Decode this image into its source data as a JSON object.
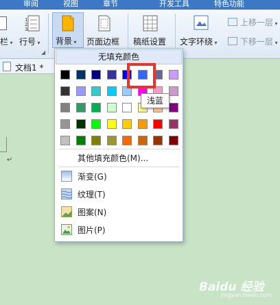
{
  "menu_tabs": [
    "审阅",
    "视图",
    "章节",
    "开发工具",
    "特色功能"
  ],
  "ribbon": {
    "left_cut_label": "栏",
    "line_spacing_label": "行号",
    "background_label": "背景",
    "page_border_label": "页面边框",
    "paper_setting_label": "稿纸设置",
    "text_wrap_label": "文字环绕",
    "bring_forward_label": "上移一层",
    "send_backward_label": "下移一层"
  },
  "document_tab": {
    "name": "文档1 *"
  },
  "dropdown": {
    "no_fill_label": "无填充颜色",
    "palette": [
      [
        "#000000",
        "#003366",
        "#000080",
        "#333399",
        "#0000ff",
        "#3366ff",
        "#666699",
        "#cc99ff"
      ],
      [
        "#333333",
        "#9999ff",
        "#33cccc",
        "#00ccff",
        "#99ccff",
        "#ff00ff",
        "#ff99cc",
        "#cc99cc"
      ],
      [
        "#808080",
        "#339966",
        "#00b050",
        "#ccffcc",
        "#ffffff",
        "#ffff99",
        "#ffcc99",
        "#800080"
      ],
      [
        "#969696",
        "#003300",
        "#00ff00",
        "#ffff00",
        "#ffcc00",
        "#ff9900",
        "#ff0000",
        "#993366"
      ],
      [
        "#c0c0c0",
        "#008000",
        "#808000",
        "#999933",
        "#ff6600",
        "#cc6600",
        "#993300",
        "#800000"
      ]
    ],
    "more_colors_label": "其他填充颜色(M)...",
    "items": [
      {
        "label": "渐变(G)",
        "icon": "gradient-icon"
      },
      {
        "label": "纹理(T)",
        "icon": "texture-icon"
      },
      {
        "label": "图案(N)",
        "icon": "pattern-icon"
      },
      {
        "label": "图片(P)",
        "icon": "picture-icon"
      }
    ]
  },
  "tooltip": {
    "text": "浅蓝"
  },
  "watermark": {
    "text": "Baidu 经验",
    "sub": "jingyan.baidu.com"
  },
  "colors": {
    "accent_blue": "#3d78c7",
    "highlight_red": "#e8342b",
    "page_green": "#c9e3c6"
  }
}
